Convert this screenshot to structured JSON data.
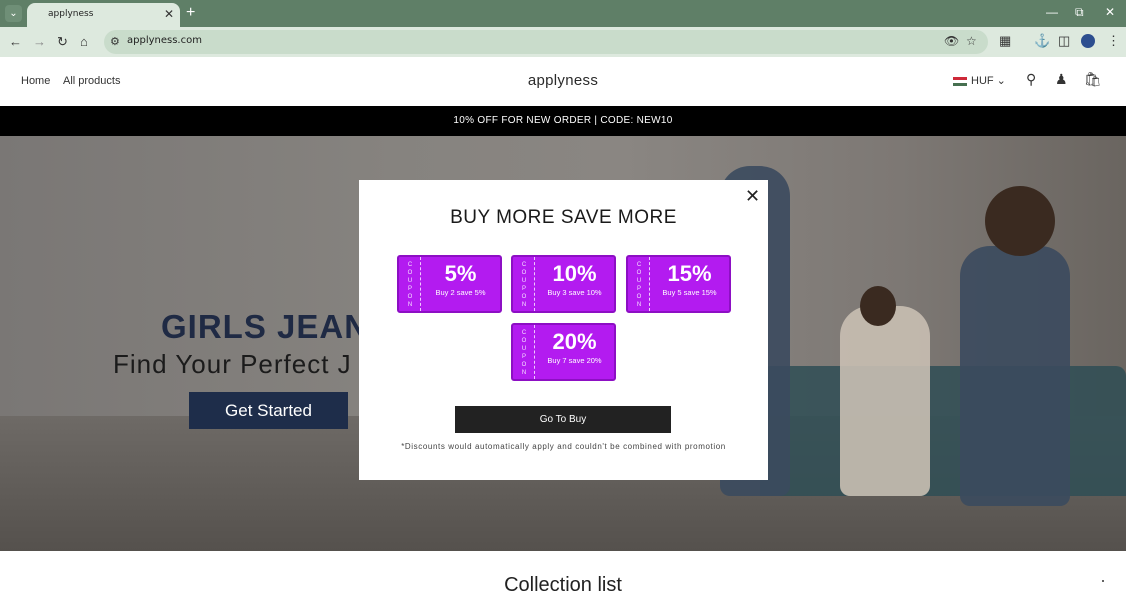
{
  "browser": {
    "tab_title": "applyness",
    "url": "applyness.com"
  },
  "header": {
    "nav": [
      "Home",
      "All products"
    ],
    "logo": "applyness",
    "currency": "HUF"
  },
  "announcement": "10% OFF FOR NEW ORDER | CODE: NEW10",
  "hero": {
    "title": "GIRLS JEAN",
    "subtitle": "Find Your Perfect J",
    "cta": "Get Started"
  },
  "collection_title": "Collection list",
  "modal": {
    "title": "BUY MORE SAVE MORE",
    "coupon_word": "COUPON",
    "coupons": [
      {
        "pct": "5%",
        "desc": "Buy 2 save 5%"
      },
      {
        "pct": "10%",
        "desc": "Buy 3 save 10%"
      },
      {
        "pct": "15%",
        "desc": "Buy 5 save 15%"
      },
      {
        "pct": "20%",
        "desc": "Buy 7 save 20%"
      }
    ],
    "button": "Go To Buy",
    "disclaimer": "*Discounts would automatically apply and couldn't be combined with promotion"
  },
  "colors": {
    "coupon": "#b31bf0",
    "announce_bg": "#000000",
    "cta_bg": "#1e2d4a"
  }
}
